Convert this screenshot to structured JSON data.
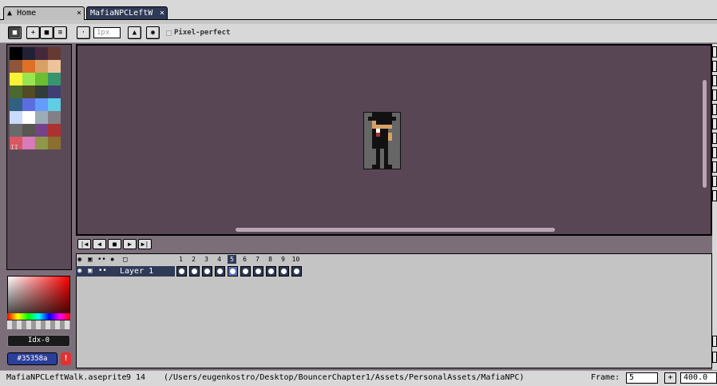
{
  "tabs": [
    {
      "label": "Home",
      "close": "×"
    },
    {
      "label": "MafiaNPCLeftW",
      "close": "×"
    }
  ],
  "toolbar": {
    "brush_size": "1px",
    "pixel_perfect_label": "Pixel-perfect"
  },
  "palette": {
    "colors": [
      "#000000",
      "#222034",
      "#45283c",
      "#663931",
      "#8f563b",
      "#df7126",
      "#d9a066",
      "#eec39a",
      "#fbf236",
      "#99e550",
      "#6abe30",
      "#37946e",
      "#4b692f",
      "#524b24",
      "#323c39",
      "#3f3f74",
      "#306082",
      "#5b6ee1",
      "#639bff",
      "#5fcde4",
      "#cbdbfc",
      "#ffffff",
      "#9badb7",
      "#847e87",
      "#696a6a",
      "#595652",
      "#76428a",
      "#ac3232",
      "#d95763",
      "#d77bba",
      "#8f974a",
      "#8a6f30"
    ],
    "index_marker": "II"
  },
  "color_picker": {
    "index_label": "Idx-0",
    "hex_value": "#35358a"
  },
  "timeline": {
    "frames": [
      "1",
      "2",
      "3",
      "4",
      "5",
      "6",
      "7",
      "8",
      "9",
      "10"
    ],
    "current_frame_index": 4,
    "layer_name": "Layer 1"
  },
  "status": {
    "filename": "MafiaNPCLeftWalk.aseprite",
    "size": "9 14",
    "path": "(/Users/eugenkostro/Desktop/BouncerChapter1/Assets/PersonalAssets/MafiaNPC)",
    "frame_label": "Frame:",
    "frame_value": "5",
    "frame_plus": "+",
    "zoom": "400.0"
  },
  "colors": {
    "canvas_bg": "#584655",
    "accent_selected": "#2f3a57",
    "hex_field_bg": "#2b3f9a",
    "warning": "#e53030"
  }
}
